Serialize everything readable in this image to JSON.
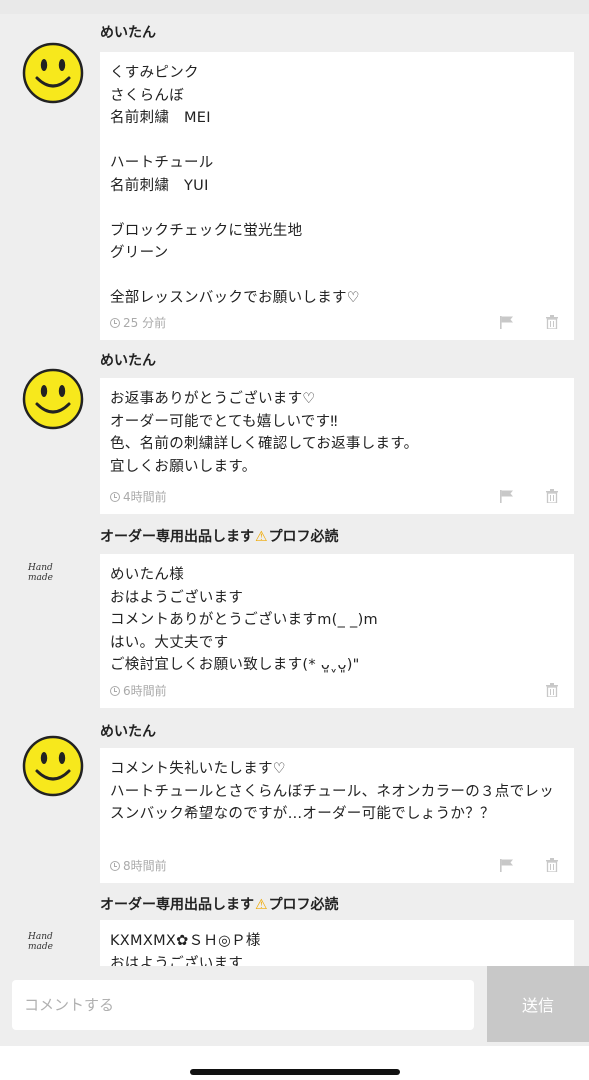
{
  "comments": [
    {
      "author": "めいたん",
      "avatar": "smiley-face",
      "body": "くすみピンク\nさくらんぼ\n名前刺繍　MEI\n\nハートチュール\n名前刺繍　YUI\n\nブロックチェックに蛍光生地\nグリーン\n\n全部レッスンバックでお願いします♡",
      "time": "25 分前",
      "has_flag": true
    },
    {
      "author": "めいたん",
      "avatar": "smiley-face",
      "body": "お返事ありがとうございます♡\nオーダー可能でとても嬉しいです‼︎\n色、名前の刺繍詳しく確認してお返事します。\n宜しくお願いします。",
      "time": "4時間前",
      "has_flag": true
    },
    {
      "author_before": "オーダー専用出品します",
      "author_warn": "⚠",
      "author_after": "プロフ必読",
      "avatar": "brand-logo",
      "avatar_text": "Hand made",
      "body": "めいたん様\nおはようございます\nコメントありがとうございますm(_ _)m\nはい。大丈夫です\nご検討宜しくお願い致します(* ᴗ͈ˬᴗ͈)\"",
      "time": "6時間前",
      "has_flag": false
    },
    {
      "author": "めいたん",
      "avatar": "smiley-face",
      "body": "コメント失礼いたします♡\nハートチュールとさくらんぼチュール、ネオンカラーの３点でレッスンバック希望なのですが…オーダー可能でしょうか？？",
      "time": "8時間前",
      "has_flag": true
    },
    {
      "author_before": "オーダー専用出品します",
      "author_warn": "⚠",
      "author_after": "プロフ必読",
      "avatar": "brand-logo",
      "avatar_text": "Hand made",
      "body": "KXMXMX✿ＳＨ◎Ｐ様\nおはようございます",
      "time": "",
      "has_flag": false
    }
  ],
  "input": {
    "placeholder": "コメントする",
    "send_label": "送信"
  },
  "colors": {
    "background": "#eeeeee",
    "bubble": "#ffffff",
    "meta": "#aaaaaa",
    "send_disabled": "#c8c8c8",
    "smiley_yellow": "#f7e81c",
    "warning": "#f0a800"
  }
}
